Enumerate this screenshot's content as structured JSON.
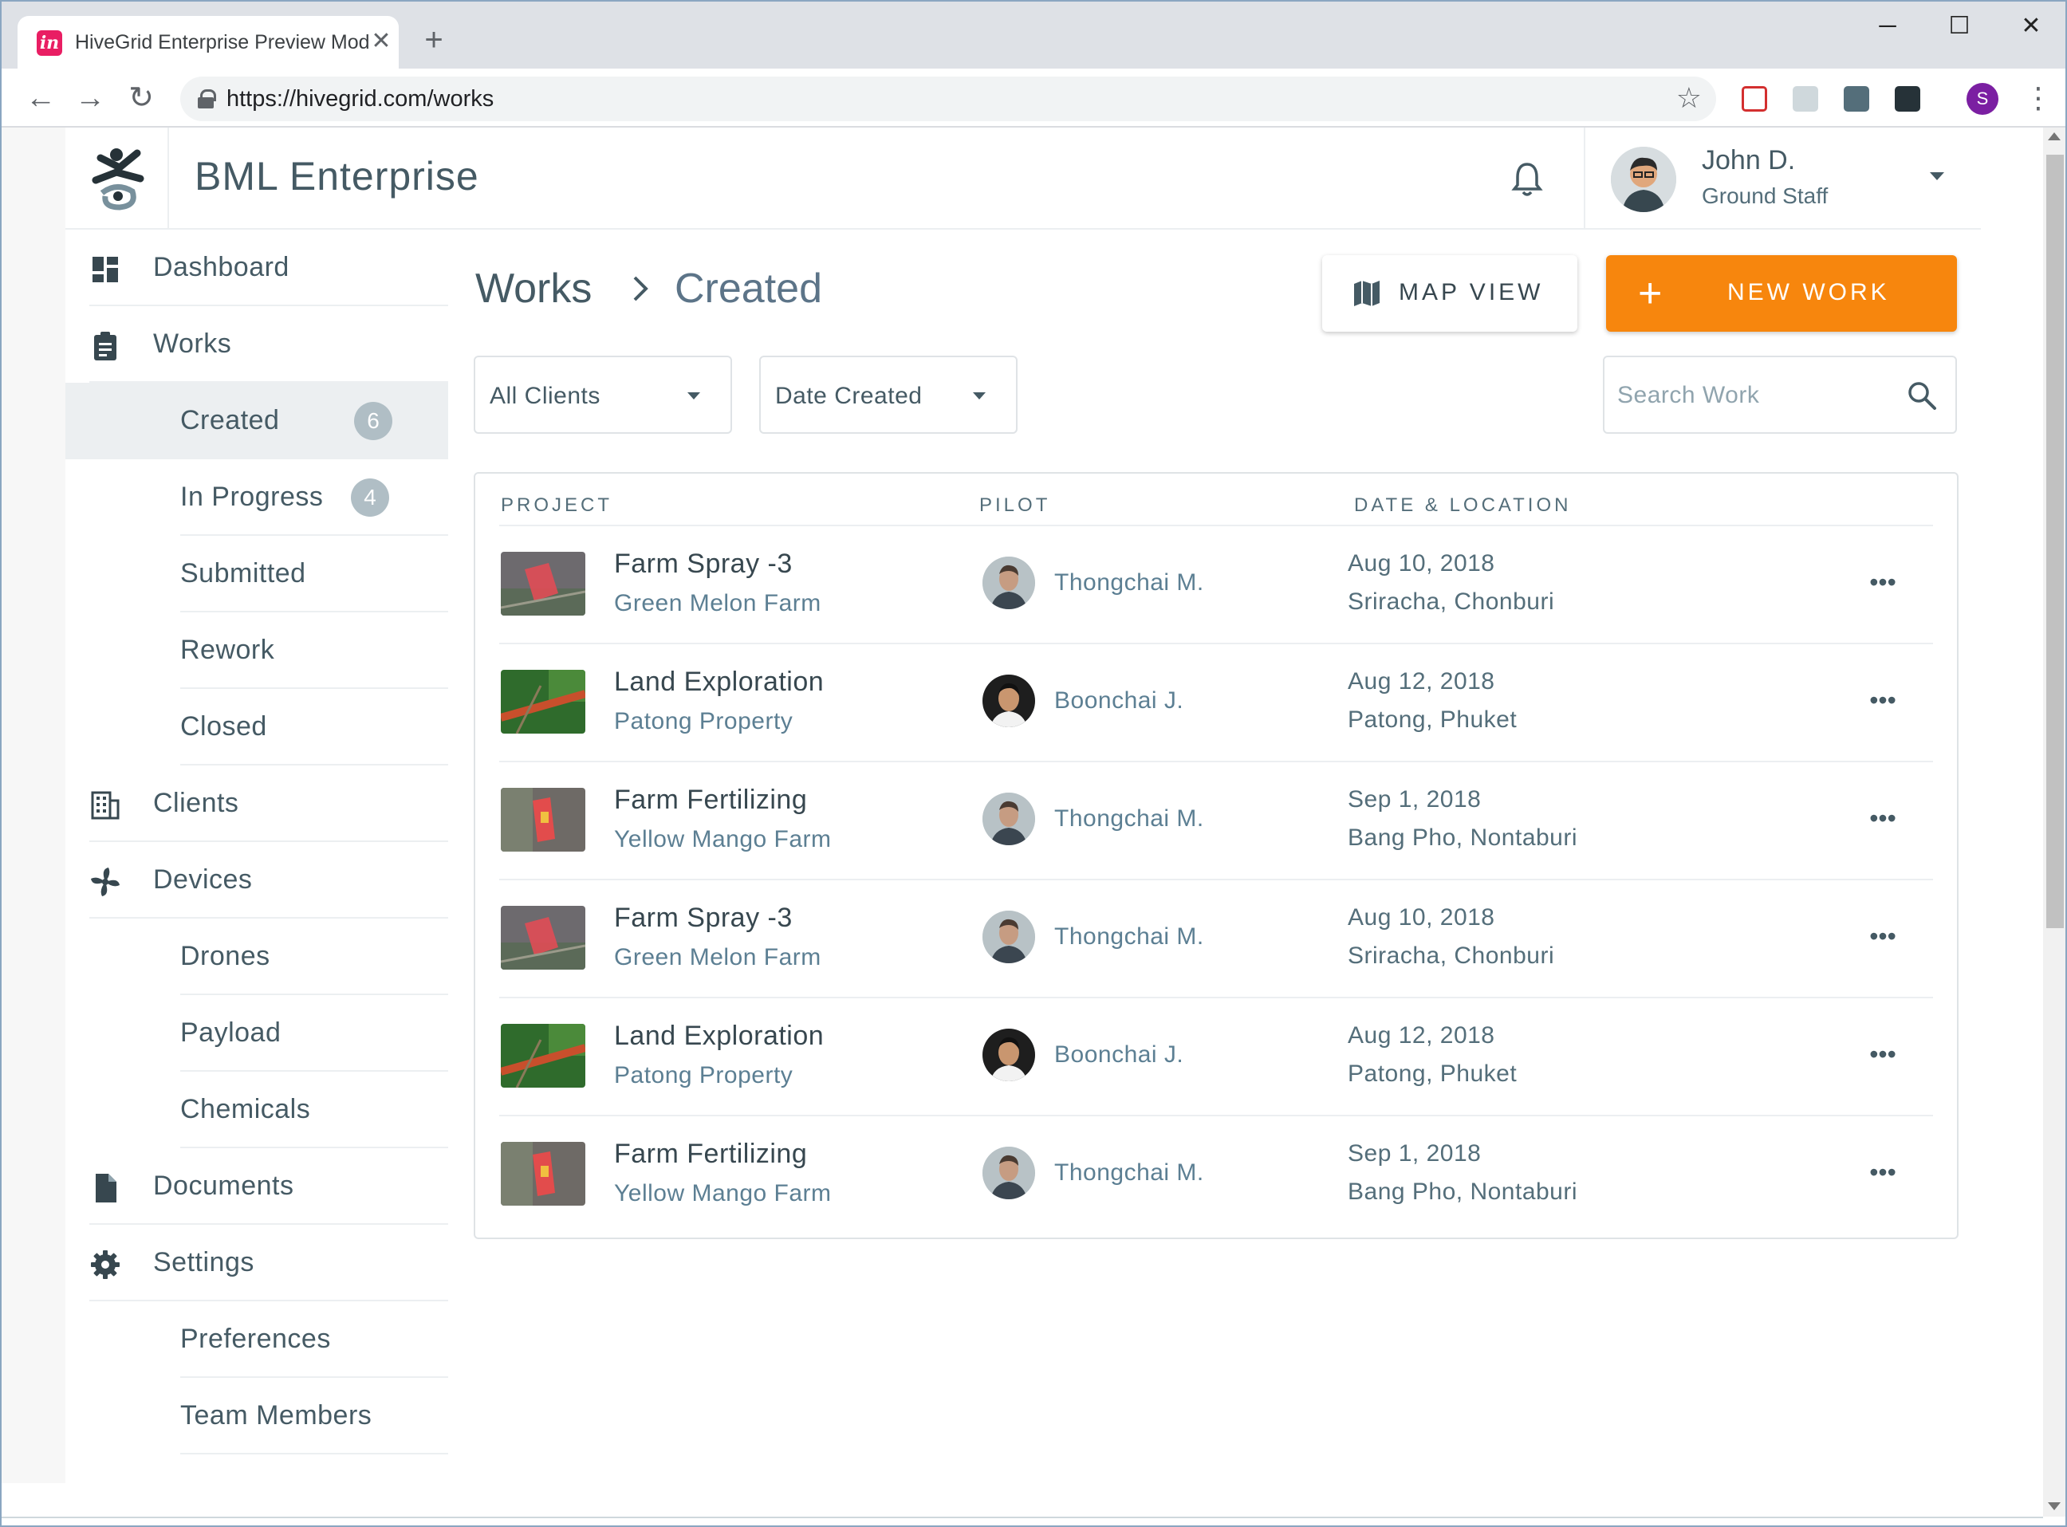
{
  "browser": {
    "tab_title": "HiveGrid Enterprise Preview Mod",
    "favicon_letter": "in",
    "url": "https://hivegrid.com/works",
    "profile_initial": "S"
  },
  "header": {
    "app_title": "BML Enterprise",
    "user": {
      "name": "John D.",
      "role": "Ground Staff"
    }
  },
  "sidebar": {
    "items": [
      {
        "label": "Dashboard",
        "icon": "dashboard-icon"
      },
      {
        "label": "Works",
        "icon": "clipboard-icon"
      },
      {
        "label": "Created",
        "badge": "6"
      },
      {
        "label": "In Progress",
        "badge": "4"
      },
      {
        "label": "Submitted"
      },
      {
        "label": "Rework"
      },
      {
        "label": "Closed"
      },
      {
        "label": "Clients",
        "icon": "building-icon"
      },
      {
        "label": "Devices",
        "icon": "propeller-icon"
      },
      {
        "label": "Drones"
      },
      {
        "label": "Payload"
      },
      {
        "label": "Chemicals"
      },
      {
        "label": "Documents",
        "icon": "document-icon"
      },
      {
        "label": "Settings",
        "icon": "gear-icon"
      },
      {
        "label": "Preferences"
      },
      {
        "label": "Team Members"
      }
    ]
  },
  "main": {
    "breadcrumb": {
      "parent": "Works",
      "current": "Created"
    },
    "map_view_label": "MAP VIEW",
    "new_work_label": "NEW WORK",
    "filters": {
      "client": "All Clients",
      "sort": "Date Created"
    },
    "search_placeholder": "Search Work",
    "table": {
      "headers": {
        "project": "PROJECT",
        "pilot": "PILOT",
        "date_location": "DATE & LOCATION"
      },
      "rows": [
        {
          "project": "Farm Spray -3",
          "farm": "Green Melon Farm",
          "pilot": "Thongchai M.",
          "date": "Aug 10, 2018",
          "location": "Sriracha, Chonburi"
        },
        {
          "project": "Land Exploration",
          "farm": "Patong Property",
          "pilot": "Boonchai J.",
          "date": "Aug 12, 2018",
          "location": "Patong, Phuket"
        },
        {
          "project": "Farm Fertilizing",
          "farm": "Yellow Mango Farm",
          "pilot": "Thongchai M.",
          "date": "Sep 1, 2018",
          "location": "Bang Pho, Nontaburi"
        },
        {
          "project": "Farm Spray -3",
          "farm": "Green Melon Farm",
          "pilot": "Thongchai M.",
          "date": "Aug 10, 2018",
          "location": "Sriracha, Chonburi"
        },
        {
          "project": "Land Exploration",
          "farm": "Patong Property",
          "pilot": "Boonchai J.",
          "date": "Aug 12, 2018",
          "location": "Patong, Phuket"
        },
        {
          "project": "Farm Fertilizing",
          "farm": "Yellow Mango Farm",
          "pilot": "Thongchai M.",
          "date": "Sep 1, 2018",
          "location": "Bang Pho, Nontaburi"
        }
      ]
    }
  },
  "colors": {
    "accent": "#f7860d",
    "text_primary": "#37474f",
    "text_link": "#5c7f93",
    "badge": "#b0bec5",
    "active_nav_bg": "#eceff1"
  }
}
